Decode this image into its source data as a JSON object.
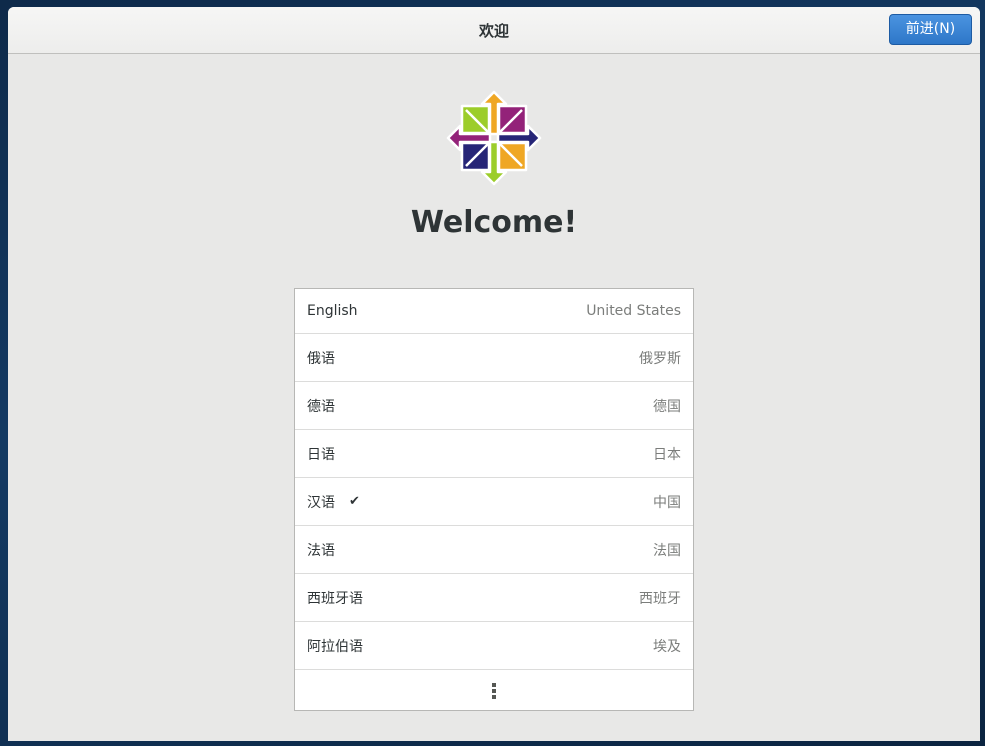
{
  "header": {
    "title": "欢迎",
    "next_label": "前进(N)"
  },
  "welcome_text": "Welcome!",
  "languages": [
    {
      "name": "English",
      "region": "United States",
      "selected": false
    },
    {
      "name": "俄语",
      "region": "俄罗斯",
      "selected": false
    },
    {
      "name": "德语",
      "region": "德国",
      "selected": false
    },
    {
      "name": "日语",
      "region": "日本",
      "selected": false
    },
    {
      "name": "汉语",
      "region": "中国",
      "selected": true
    },
    {
      "name": "法语",
      "region": "法国",
      "selected": false
    },
    {
      "name": "西班牙语",
      "region": "西班牙",
      "selected": false
    },
    {
      "name": "阿拉伯语",
      "region": "埃及",
      "selected": false
    }
  ],
  "check_glyph": "✔",
  "colors": {
    "accent": "#2e77c8",
    "logo_green": "#9ccd2a",
    "logo_orange": "#efa724",
    "logo_purple": "#932279",
    "logo_navy": "#262577"
  }
}
